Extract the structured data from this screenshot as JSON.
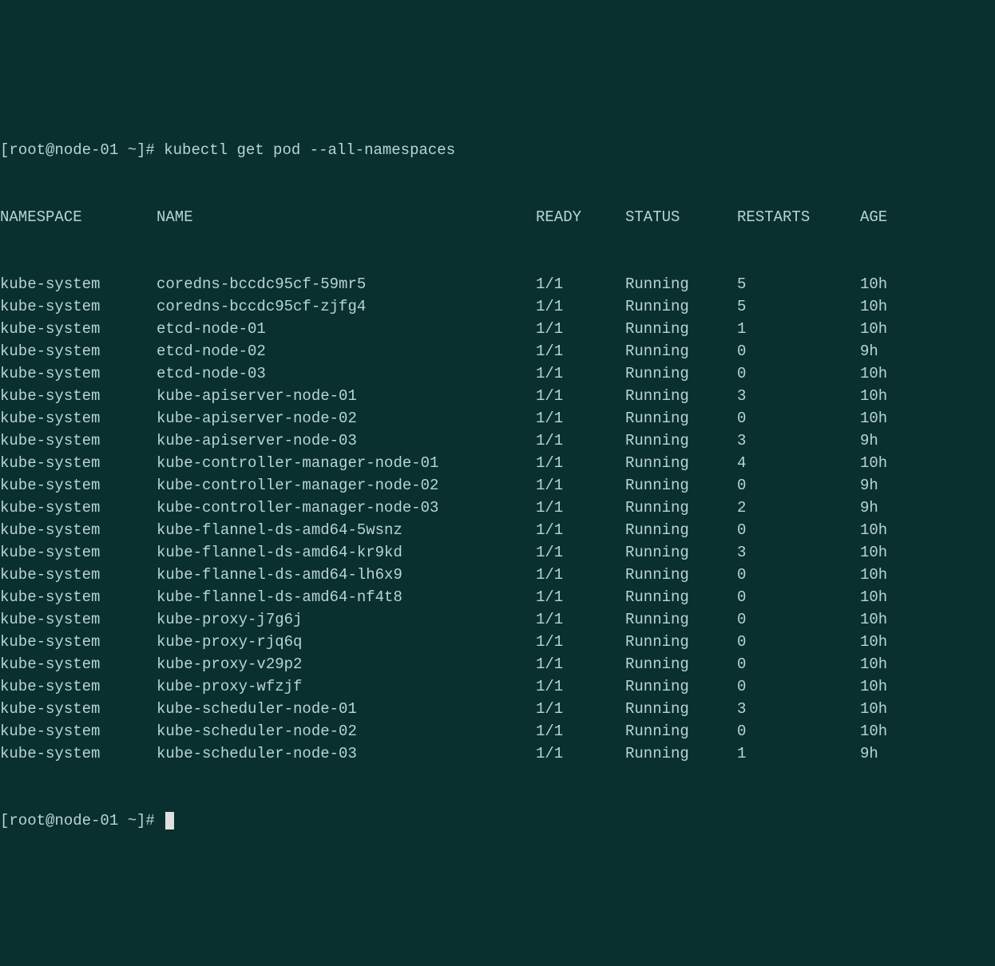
{
  "prompt1": "[root@node-01 ~]# ",
  "command": "kubectl get pod --all-namespaces",
  "prompt2": "[root@node-01 ~]# ",
  "headers": {
    "namespace": "NAMESPACE",
    "name": "NAME",
    "ready": "READY",
    "status": "STATUS",
    "restarts": "RESTARTS",
    "age": "AGE"
  },
  "rows": [
    {
      "namespace": "kube-system",
      "name": "coredns-bccdc95cf-59mr5",
      "ready": "1/1",
      "status": "Running",
      "restarts": "5",
      "age": "10h"
    },
    {
      "namespace": "kube-system",
      "name": "coredns-bccdc95cf-zjfg4",
      "ready": "1/1",
      "status": "Running",
      "restarts": "5",
      "age": "10h"
    },
    {
      "namespace": "kube-system",
      "name": "etcd-node-01",
      "ready": "1/1",
      "status": "Running",
      "restarts": "1",
      "age": "10h"
    },
    {
      "namespace": "kube-system",
      "name": "etcd-node-02",
      "ready": "1/1",
      "status": "Running",
      "restarts": "0",
      "age": "9h"
    },
    {
      "namespace": "kube-system",
      "name": "etcd-node-03",
      "ready": "1/1",
      "status": "Running",
      "restarts": "0",
      "age": "10h"
    },
    {
      "namespace": "kube-system",
      "name": "kube-apiserver-node-01",
      "ready": "1/1",
      "status": "Running",
      "restarts": "3",
      "age": "10h"
    },
    {
      "namespace": "kube-system",
      "name": "kube-apiserver-node-02",
      "ready": "1/1",
      "status": "Running",
      "restarts": "0",
      "age": "10h"
    },
    {
      "namespace": "kube-system",
      "name": "kube-apiserver-node-03",
      "ready": "1/1",
      "status": "Running",
      "restarts": "3",
      "age": "9h"
    },
    {
      "namespace": "kube-system",
      "name": "kube-controller-manager-node-01",
      "ready": "1/1",
      "status": "Running",
      "restarts": "4",
      "age": "10h"
    },
    {
      "namespace": "kube-system",
      "name": "kube-controller-manager-node-02",
      "ready": "1/1",
      "status": "Running",
      "restarts": "0",
      "age": "9h"
    },
    {
      "namespace": "kube-system",
      "name": "kube-controller-manager-node-03",
      "ready": "1/1",
      "status": "Running",
      "restarts": "2",
      "age": "9h"
    },
    {
      "namespace": "kube-system",
      "name": "kube-flannel-ds-amd64-5wsnz",
      "ready": "1/1",
      "status": "Running",
      "restarts": "0",
      "age": "10h"
    },
    {
      "namespace": "kube-system",
      "name": "kube-flannel-ds-amd64-kr9kd",
      "ready": "1/1",
      "status": "Running",
      "restarts": "3",
      "age": "10h"
    },
    {
      "namespace": "kube-system",
      "name": "kube-flannel-ds-amd64-lh6x9",
      "ready": "1/1",
      "status": "Running",
      "restarts": "0",
      "age": "10h"
    },
    {
      "namespace": "kube-system",
      "name": "kube-flannel-ds-amd64-nf4t8",
      "ready": "1/1",
      "status": "Running",
      "restarts": "0",
      "age": "10h"
    },
    {
      "namespace": "kube-system",
      "name": "kube-proxy-j7g6j",
      "ready": "1/1",
      "status": "Running",
      "restarts": "0",
      "age": "10h"
    },
    {
      "namespace": "kube-system",
      "name": "kube-proxy-rjq6q",
      "ready": "1/1",
      "status": "Running",
      "restarts": "0",
      "age": "10h"
    },
    {
      "namespace": "kube-system",
      "name": "kube-proxy-v29p2",
      "ready": "1/1",
      "status": "Running",
      "restarts": "0",
      "age": "10h"
    },
    {
      "namespace": "kube-system",
      "name": "kube-proxy-wfzjf",
      "ready": "1/1",
      "status": "Running",
      "restarts": "0",
      "age": "10h"
    },
    {
      "namespace": "kube-system",
      "name": "kube-scheduler-node-01",
      "ready": "1/1",
      "status": "Running",
      "restarts": "3",
      "age": "10h"
    },
    {
      "namespace": "kube-system",
      "name": "kube-scheduler-node-02",
      "ready": "1/1",
      "status": "Running",
      "restarts": "0",
      "age": "10h"
    },
    {
      "namespace": "kube-system",
      "name": "kube-scheduler-node-03",
      "ready": "1/1",
      "status": "Running",
      "restarts": "1",
      "age": "9h"
    }
  ]
}
